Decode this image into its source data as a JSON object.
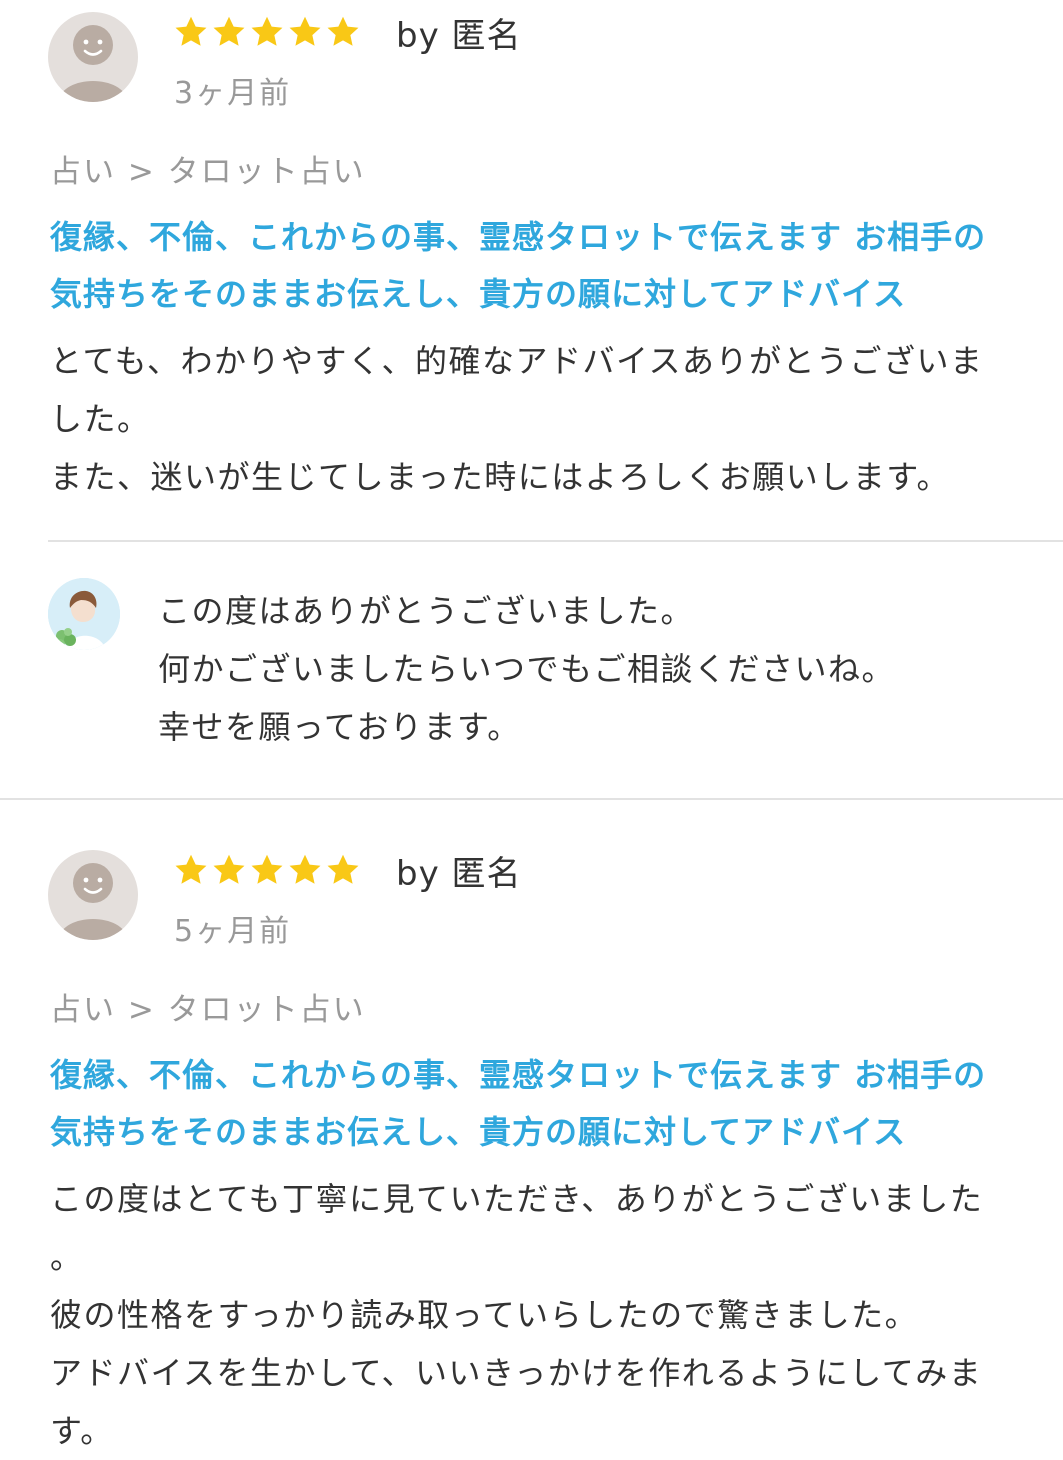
{
  "reviews": [
    {
      "rating": 5,
      "author": "by 匿名",
      "date": "3ヶ月前",
      "category": "占い > タロット占い",
      "service_title": "復縁、不倫、これからの事、霊感タロットで伝えます お相手の\n気持ちをそのままお伝えし、貴方の願に対してアドバイス",
      "body": "とても、わかりやすく、的確なアドバイスありがとうございま\nした。\nまた、迷いが生じてしまった時にはよろしくお願いします。",
      "reply": "この度はありがとうございました。\n何かございましたらいつでもご相談くださいね。\n幸せを願っております。"
    },
    {
      "rating": 5,
      "author": "by 匿名",
      "date": "5ヶ月前",
      "category": "占い > タロット占い",
      "service_title": "復縁、不倫、これからの事、霊感タロットで伝えます お相手の\n気持ちをそのままお伝えし、貴方の願に対してアドバイス",
      "body": "この度はとても丁寧に見ていただき、ありがとうございました\n。\n彼の性格をすっかり読み取っていらしたので驚きました。\nアドバイスを生かして、いいきっかけを作れるようにしてみま\nす。"
    }
  ],
  "colors": {
    "star": "#f9c816",
    "link": "#2fa7dd",
    "muted": "#999999",
    "text": "#333333",
    "divider": "#e2e2e2",
    "avatar_bg": "#e4dfdc",
    "avatar_fg": "#b9aca3"
  },
  "icons": {
    "avatar": "default-user-avatar-icon",
    "star": "star-icon",
    "seller_avatar": "seller-avatar-icon"
  }
}
